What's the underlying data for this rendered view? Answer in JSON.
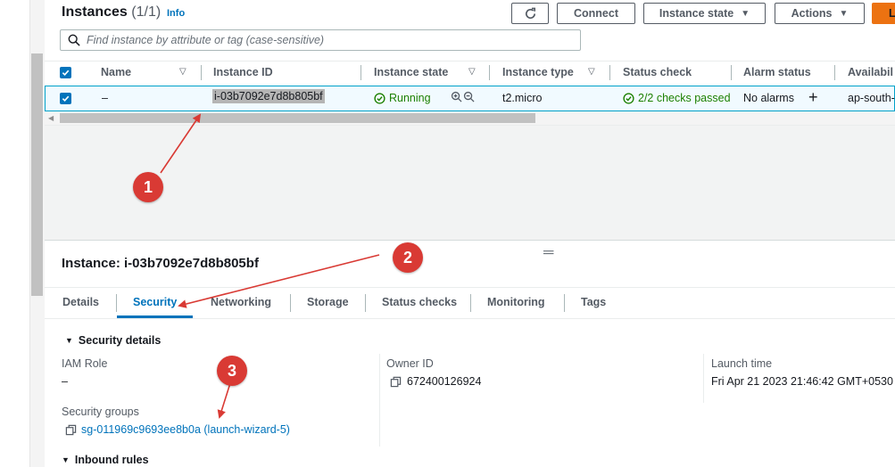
{
  "header": {
    "title": "Instances",
    "count": "(1/1)",
    "info": "Info",
    "buttons": {
      "refresh": "refresh-icon",
      "connect": "Connect",
      "instance_state": "Instance state",
      "actions": "Actions",
      "launch": "L"
    }
  },
  "search": {
    "placeholder": "Find instance by attribute or tag (case-sensitive)"
  },
  "table": {
    "columns": [
      "Name",
      "Instance ID",
      "Instance state",
      "Instance type",
      "Status check",
      "Alarm status",
      "Availabil"
    ],
    "row": {
      "name": "–",
      "instance_id": "i-03b7092e7d8b805bf",
      "state": "Running",
      "type": "t2.micro",
      "status_check": "2/2 checks passed",
      "alarm": "No alarms",
      "availability": "ap-south-"
    }
  },
  "details": {
    "title": "Instance: i-03b7092e7d8b805bf",
    "tabs": [
      "Details",
      "Security",
      "Networking",
      "Storage",
      "Status checks",
      "Monitoring",
      "Tags"
    ],
    "active_tab": "Security",
    "security_details_heading": "Security details",
    "iam_role_label": "IAM Role",
    "iam_role_value": "–",
    "owner_id_label": "Owner ID",
    "owner_id_value": "672400126924",
    "launch_time_label": "Launch time",
    "launch_time_value": "Fri Apr 21 2023 21:46:42 GMT+0530",
    "security_groups_label": "Security groups",
    "security_group_link": "sg-011969c9693ee8b0a (launch-wizard-5)",
    "inbound_rules_heading": "Inbound rules"
  },
  "annotations": {
    "m1": "1",
    "m2": "2",
    "m3": "3"
  },
  "colors": {
    "link": "#0073bb",
    "success": "#1d8102",
    "marker": "#d93a34",
    "accent": "#ec7211"
  }
}
